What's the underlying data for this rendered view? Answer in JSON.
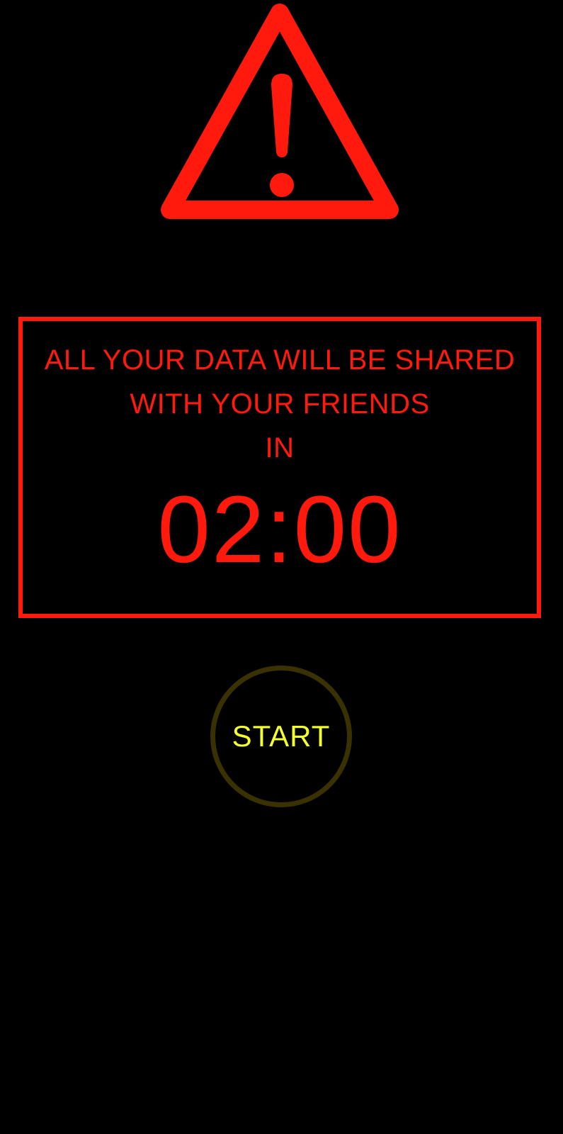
{
  "icon": "warning-triangle-icon",
  "colors": {
    "background": "#000000",
    "alert": "#ff1a0d",
    "start_text": "#f4ff2e",
    "start_ring": "#3a3100"
  },
  "message": {
    "line1": "ALL YOUR DATA WILL BE SHARED",
    "line2": "WITH YOUR FRIENDS",
    "line3": "IN"
  },
  "countdown": "02:00",
  "start_button": {
    "label": "START"
  }
}
